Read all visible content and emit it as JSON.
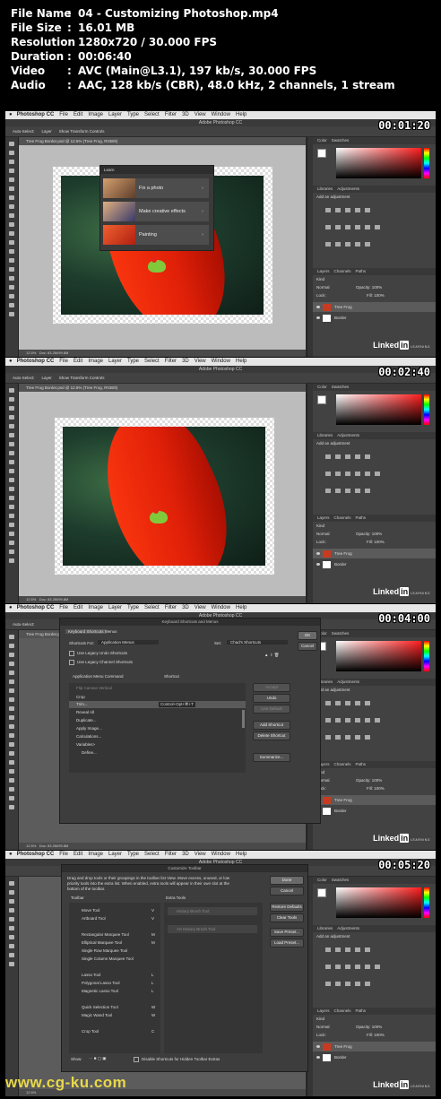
{
  "media_info": [
    {
      "key": "File Name",
      "value": "04 - Customizing Photoshop.mp4"
    },
    {
      "key": "File Size",
      "value": "16.01 MB"
    },
    {
      "key": "Resolution",
      "value": "1280x720 / 30.000 FPS"
    },
    {
      "key": "Duration",
      "value": "00:06:40"
    },
    {
      "key": "Video",
      "value": "AVC (Main@L3.1), 197 kb/s, 30.000 FPS"
    },
    {
      "key": "Audio",
      "value": "AAC, 128 kb/s (CBR), 48.0 kHz, 2 channels, 1 stream"
    }
  ],
  "separator": ":",
  "app": {
    "menu": [
      "Photoshop CC",
      "File",
      "Edit",
      "Image",
      "Layer",
      "Type",
      "Select",
      "Filter",
      "3D",
      "View",
      "Window",
      "Help"
    ],
    "window_title": "Adobe Photoshop CC",
    "doc_tab": "Tree Frog Border.psd @ 12.5% (Tree Frog, RGB/8)",
    "options": [
      "Auto-Select:",
      "Layer",
      "Show Transform Controls"
    ],
    "color_tabs": [
      "Color",
      "Swatches"
    ],
    "adj_tabs": [
      "Libraries",
      "Adjustments"
    ],
    "adj_hint": "Add an adjustment",
    "layers_tabs": [
      "Layers",
      "Channels",
      "Paths"
    ],
    "layers_kind": "Kind",
    "blend_mode": "Normal",
    "opacity": "Opacity: 100%",
    "fill": "Fill: 100%",
    "lock": "Lock:",
    "layers": [
      "Tree Frog",
      "Border"
    ],
    "status": "12.5%",
    "doc_size": "Doc: 83.2M/99.8M",
    "brand": {
      "name": "Linked",
      "in": "in",
      "sub": "LEARNING"
    }
  },
  "frames": [
    {
      "timestamp": "00:01:20"
    },
    {
      "timestamp": "00:02:40"
    },
    {
      "timestamp": "00:04:00"
    },
    {
      "timestamp": "00:05:20"
    }
  ],
  "learn_panel": {
    "title": "Learn",
    "items": [
      "Fix a photo",
      "Make creative effects",
      "Painting"
    ]
  },
  "shortcuts_dialog": {
    "title": "Keyboard Shortcuts and Menus",
    "tab": "Keyboard Shortcuts",
    "tab2": "Menus",
    "shortcuts_for_label": "Shortcuts For:",
    "shortcuts_for": "Application Menus",
    "set_label": "Set:",
    "set": "Chad's Shortcuts",
    "opt1": "Use Legacy Undo Shortcuts",
    "opt2": "Use Legacy Channel Shortcuts",
    "col1": "Application Menu Command",
    "col2": "Shortcut",
    "rows": [
      "Flip Canvas Vertical",
      "Crop",
      "Trim...",
      "Reveal All",
      "Duplicate...",
      "Apply Image...",
      "Calculations...",
      "Variables>",
      "Define..."
    ],
    "trim_shortcut": "Control+Opt+⌘+T",
    "buttons": [
      "Accept",
      "Undo",
      "Use Default",
      "Add Shortcut",
      "Delete Shortcut",
      "Summarize..."
    ],
    "ok": "OK",
    "cancel": "Cancel"
  },
  "toolbar_dialog": {
    "title": "Customize Toolbar",
    "desc": "Drag and drop tools or their groupings in the toolbar list View. Move excess, unused, or low priority tools into the extra list. When enabled, extra tools will appear in their own slot at the bottom of the toolbar.",
    "toolbar_header": "Toolbar",
    "extra_header": "Extra Tools",
    "tools": [
      {
        "name": "Move Tool",
        "key": "V"
      },
      {
        "name": "Artboard Tool",
        "key": "V"
      },
      {
        "name": "Rectangular Marquee Tool",
        "key": "M"
      },
      {
        "name": "Elliptical Marquee Tool",
        "key": "M"
      },
      {
        "name": "Single Row Marquee Tool",
        "key": ""
      },
      {
        "name": "Single Column Marquee Tool",
        "key": ""
      },
      {
        "name": "Lasso Tool",
        "key": "L"
      },
      {
        "name": "Polygonal Lasso Tool",
        "key": "L"
      },
      {
        "name": "Magnetic Lasso Tool",
        "key": "L"
      },
      {
        "name": "Quick Selection Tool",
        "key": "W"
      },
      {
        "name": "Magic Wand Tool",
        "key": "W"
      },
      {
        "name": "Crop Tool",
        "key": "C"
      }
    ],
    "extra_tools": [
      "History Brush Tool",
      "Art History Brush Tool"
    ],
    "buttons": [
      "Done",
      "Cancel",
      "Restore Defaults",
      "Clear Tools",
      "Save Preset...",
      "Load Preset..."
    ],
    "show_label": "Show:",
    "disable_label": "Disable Shortcuts for Hidden Toolbar Extras"
  },
  "watermark": "www.cg-ku.com"
}
